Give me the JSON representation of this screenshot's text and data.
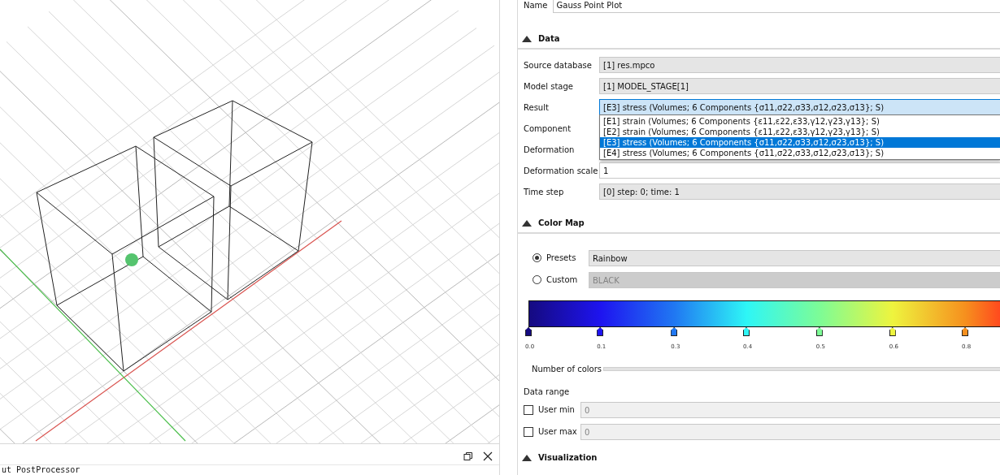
{
  "dock": {
    "console_text": "ut PostProcessor"
  },
  "name": {
    "label": "Name",
    "value": "Gauss Point Plot"
  },
  "data_section": {
    "title": "Data",
    "expanded": true,
    "fields": [
      {
        "label": "Source database",
        "kind": "combo",
        "value": "[1] res.mpco"
      },
      {
        "label": "Model stage",
        "kind": "combo",
        "value": "[1] MODEL_STAGE[1]"
      },
      {
        "label": "Result",
        "kind": "combo",
        "value": "[E3] stress (Volumes; 6 Components {σ11,σ22,σ33,σ12,σ23,σ13}; S)",
        "open": true,
        "options": [
          {
            "label": "[E1] strain (Volumes; 6 Components {ε11,ε22,ε33,γ12,γ23,γ13}; S)",
            "selected": false
          },
          {
            "label": "[E2] strain (Volumes; 6 Components {ε11,ε22,ε33,γ12,γ23,γ13}; S)",
            "selected": false
          },
          {
            "label": "[E3] stress (Volumes; 6 Components {σ11,σ22,σ33,σ12,σ23,σ13}; S)",
            "selected": true
          },
          {
            "label": "[E4] stress (Volumes; 6 Components {σ11,σ22,σ33,σ12,σ23,σ13}; S)",
            "selected": false
          }
        ]
      },
      {
        "label": "Component",
        "kind": "combo"
      },
      {
        "label": "Deformation",
        "kind": "combo"
      },
      {
        "label": "Deformation scale",
        "kind": "text",
        "value": "1"
      },
      {
        "label": "Time step",
        "kind": "combo",
        "value": "[0] step: 0; time: 1"
      }
    ]
  },
  "color_map": {
    "title": "Color Map",
    "expanded": true,
    "modes": [
      {
        "label": "Presets",
        "selected": true,
        "value": "Rainbow"
      },
      {
        "label": "Custom",
        "selected": false,
        "value": "BLACK"
      }
    ],
    "stops": [
      {
        "label": "0.0",
        "level": 0.0,
        "color": "#150a80"
      },
      {
        "label": "0.1",
        "level": 0.152,
        "color": "#1e14f0"
      },
      {
        "label": "0.3",
        "level": 0.309,
        "color": "#2078f2"
      },
      {
        "label": "0.4",
        "level": 0.462,
        "color": "#2ef6f6"
      },
      {
        "label": "0.5",
        "level": 0.617,
        "color": "#7dfc96"
      },
      {
        "label": "0.6",
        "level": 0.772,
        "color": "#eef43e"
      },
      {
        "label": "0.8",
        "level": 0.926,
        "color": "#f6901e"
      }
    ],
    "number_of_colors": {
      "label": "Number of colors"
    },
    "data_range": {
      "label": "Data range",
      "rows": [
        {
          "label": "User min",
          "checked": false,
          "value": "0"
        },
        {
          "label": "User max",
          "checked": false,
          "value": "0"
        }
      ]
    }
  },
  "visualization": {
    "title": "Visualization",
    "expanded": true
  }
}
